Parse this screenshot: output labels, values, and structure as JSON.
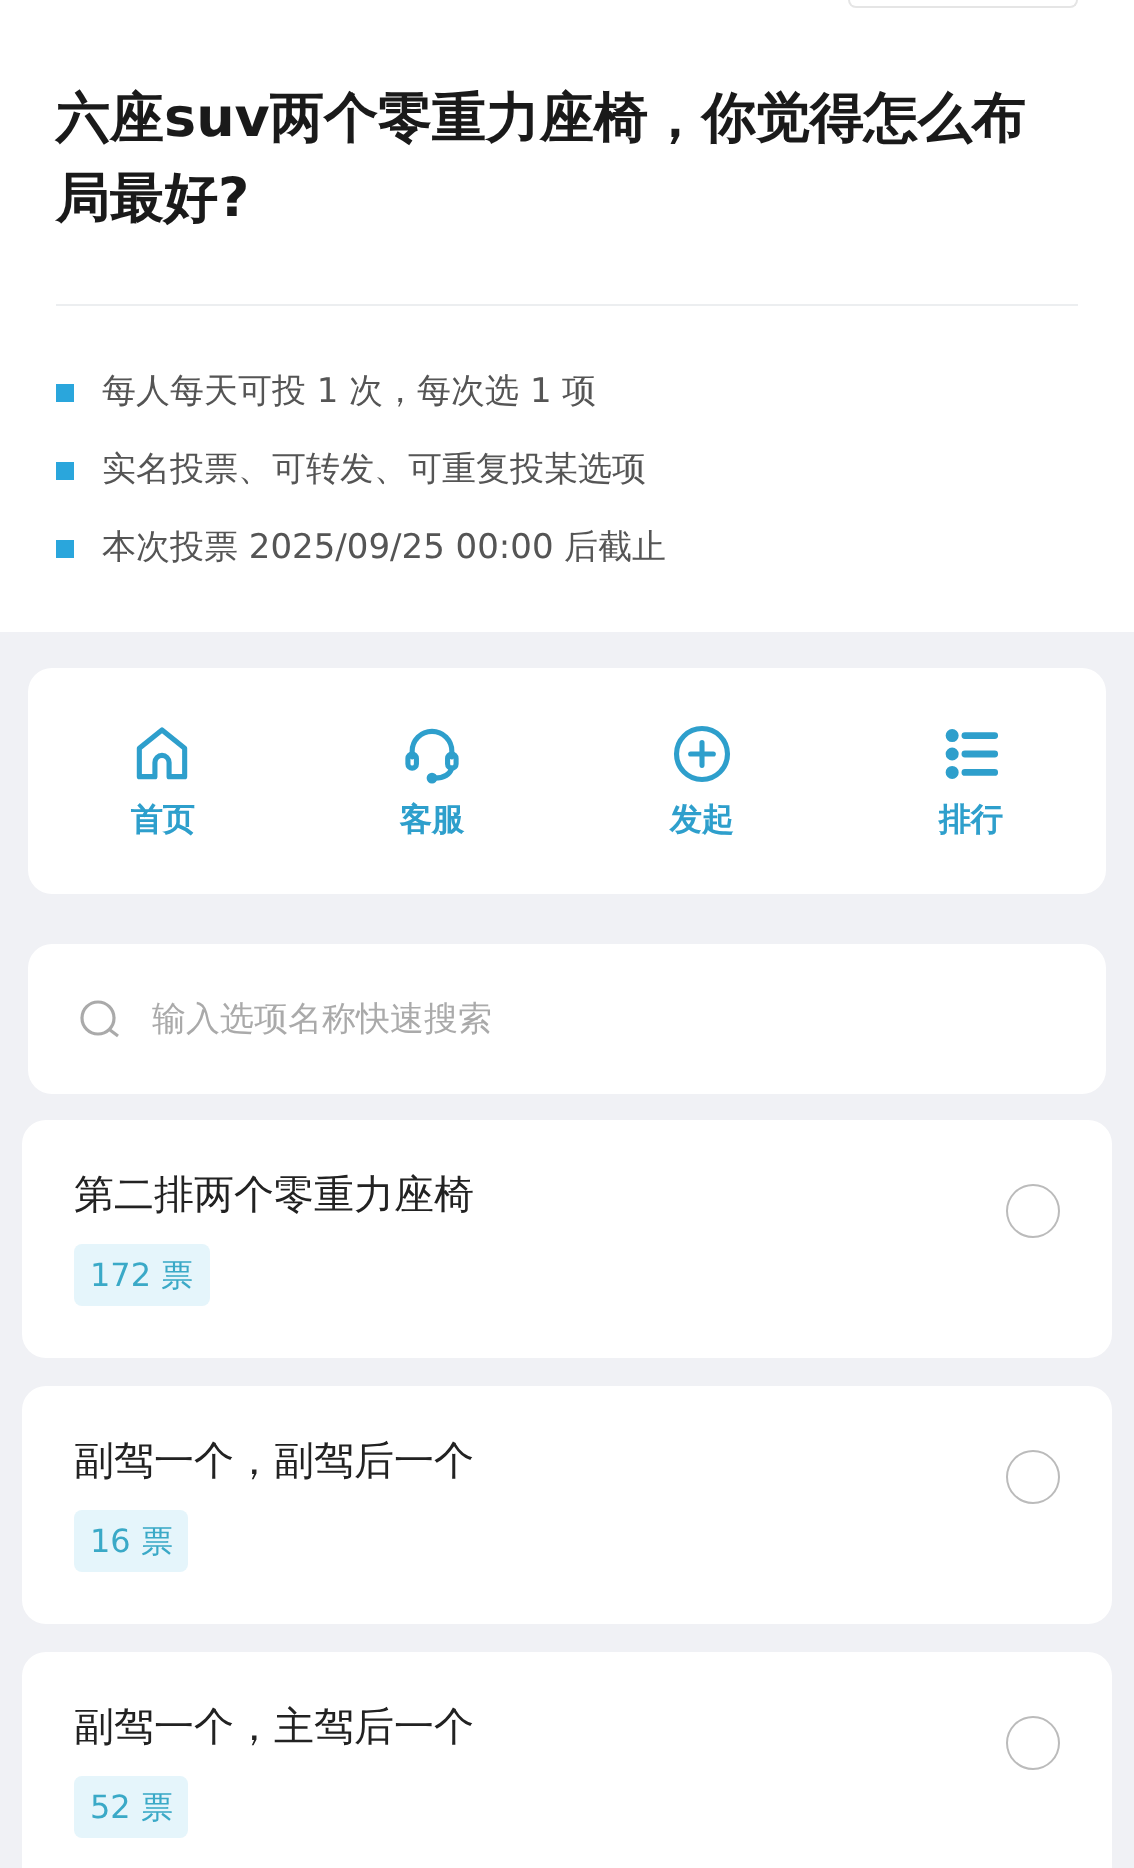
{
  "title": "六座suv两个零重力座椅，你觉得怎么布局最好?",
  "rules": [
    "每人每天可投 1 次，每次选 1 项",
    "实名投票、可转发、可重复投某选项",
    "本次投票 2025/09/25 00:00 后截止"
  ],
  "nav": [
    {
      "kind": "home",
      "label": "首页"
    },
    {
      "kind": "headset",
      "label": "客服"
    },
    {
      "kind": "add",
      "label": "发起"
    },
    {
      "kind": "ranking",
      "label": "排行"
    }
  ],
  "search": {
    "placeholder": "输入选项名称快速搜索"
  },
  "options": [
    {
      "name": "第二排两个零重力座椅",
      "votes": "172 票",
      "selected": false
    },
    {
      "name": "副驾一个，副驾后一个",
      "votes": "16 票",
      "selected": false
    },
    {
      "name": "副驾一个，主驾后一个",
      "votes": "52 票",
      "selected": false
    }
  ]
}
